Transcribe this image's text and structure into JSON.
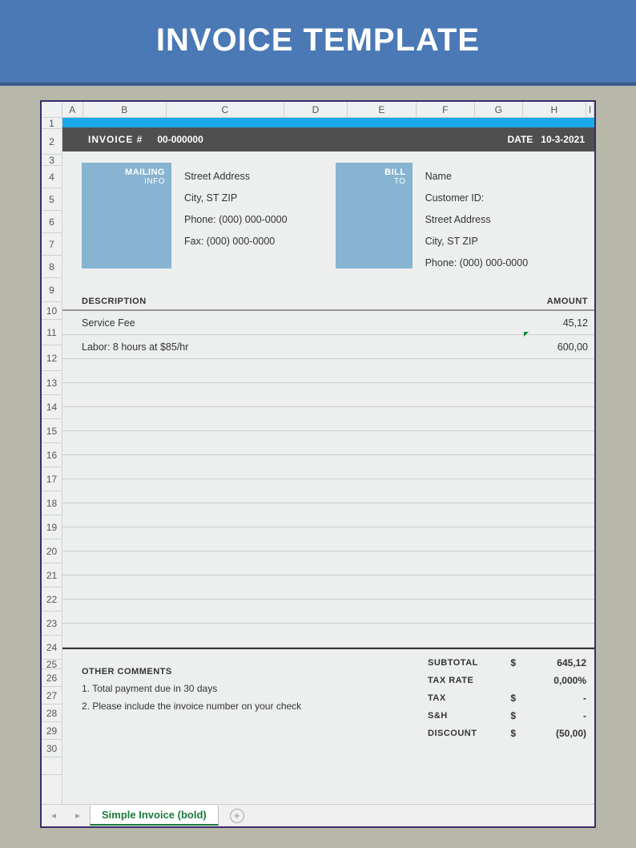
{
  "banner_title": "INVOICE TEMPLATE",
  "columns": [
    "A",
    "B",
    "C",
    "D",
    "E",
    "F",
    "G",
    "H",
    "I"
  ],
  "rows": {
    "heights": [
      14,
      32,
      14,
      28,
      28,
      28,
      28,
      28,
      30,
      22,
      32,
      32,
      30,
      30,
      30,
      30,
      30,
      30,
      30,
      30,
      30,
      30,
      30,
      30,
      12,
      22,
      22,
      22,
      22,
      22,
      22
    ],
    "labels": [
      "1",
      "2",
      "3",
      "4",
      "5",
      "6",
      "7",
      "8",
      "9",
      "10",
      "11",
      "12",
      "13",
      "14",
      "15",
      "16",
      "17",
      "18",
      "19",
      "20",
      "21",
      "22",
      "23",
      "24",
      "25",
      "26",
      "27",
      "28",
      "29",
      "30",
      ""
    ]
  },
  "header": {
    "invoice_label": "INVOICE #",
    "invoice_number": "00-000000",
    "date_label": "DATE",
    "date_value": "10-3-2021"
  },
  "mailing": {
    "title": "MAILING",
    "sub": "INFO",
    "lines": [
      "Street Address",
      "City, ST  ZIP",
      "Phone: (000) 000-0000",
      "Fax: (000) 000-0000"
    ]
  },
  "billto": {
    "title": "BILL",
    "sub": "TO",
    "lines": [
      "Name",
      "Customer ID:",
      "Street Address",
      "City, ST  ZIP",
      "Phone: (000) 000-0000"
    ]
  },
  "desc_header": {
    "description": "DESCRIPTION",
    "amount": "AMOUNT"
  },
  "items": [
    {
      "description": "Service Fee",
      "amount": "45,12"
    },
    {
      "description": "Labor: 8 hours at $85/hr",
      "amount": "600,00"
    },
    {
      "description": "",
      "amount": ""
    },
    {
      "description": "",
      "amount": ""
    },
    {
      "description": "",
      "amount": ""
    },
    {
      "description": "",
      "amount": ""
    },
    {
      "description": "",
      "amount": ""
    },
    {
      "description": "",
      "amount": ""
    },
    {
      "description": "",
      "amount": ""
    },
    {
      "description": "",
      "amount": ""
    },
    {
      "description": "",
      "amount": ""
    },
    {
      "description": "",
      "amount": ""
    },
    {
      "description": "",
      "amount": ""
    },
    {
      "description": "",
      "amount": ""
    }
  ],
  "comments": {
    "title": "OTHER COMMENTS",
    "lines": [
      "1. Total payment due in 30 days",
      "2. Please include the invoice number on your check"
    ]
  },
  "totals": [
    {
      "label": "SUBTOTAL",
      "currency": "$",
      "value": "645,12"
    },
    {
      "label": "TAX RATE",
      "currency": "",
      "value": "0,000%"
    },
    {
      "label": "TAX",
      "currency": "$",
      "value": "-"
    },
    {
      "label": "S&H",
      "currency": "$",
      "value": "-"
    },
    {
      "label": "DISCOUNT",
      "currency": "$",
      "value": "(50,00)"
    }
  ],
  "tab_name": "Simple Invoice (bold)"
}
